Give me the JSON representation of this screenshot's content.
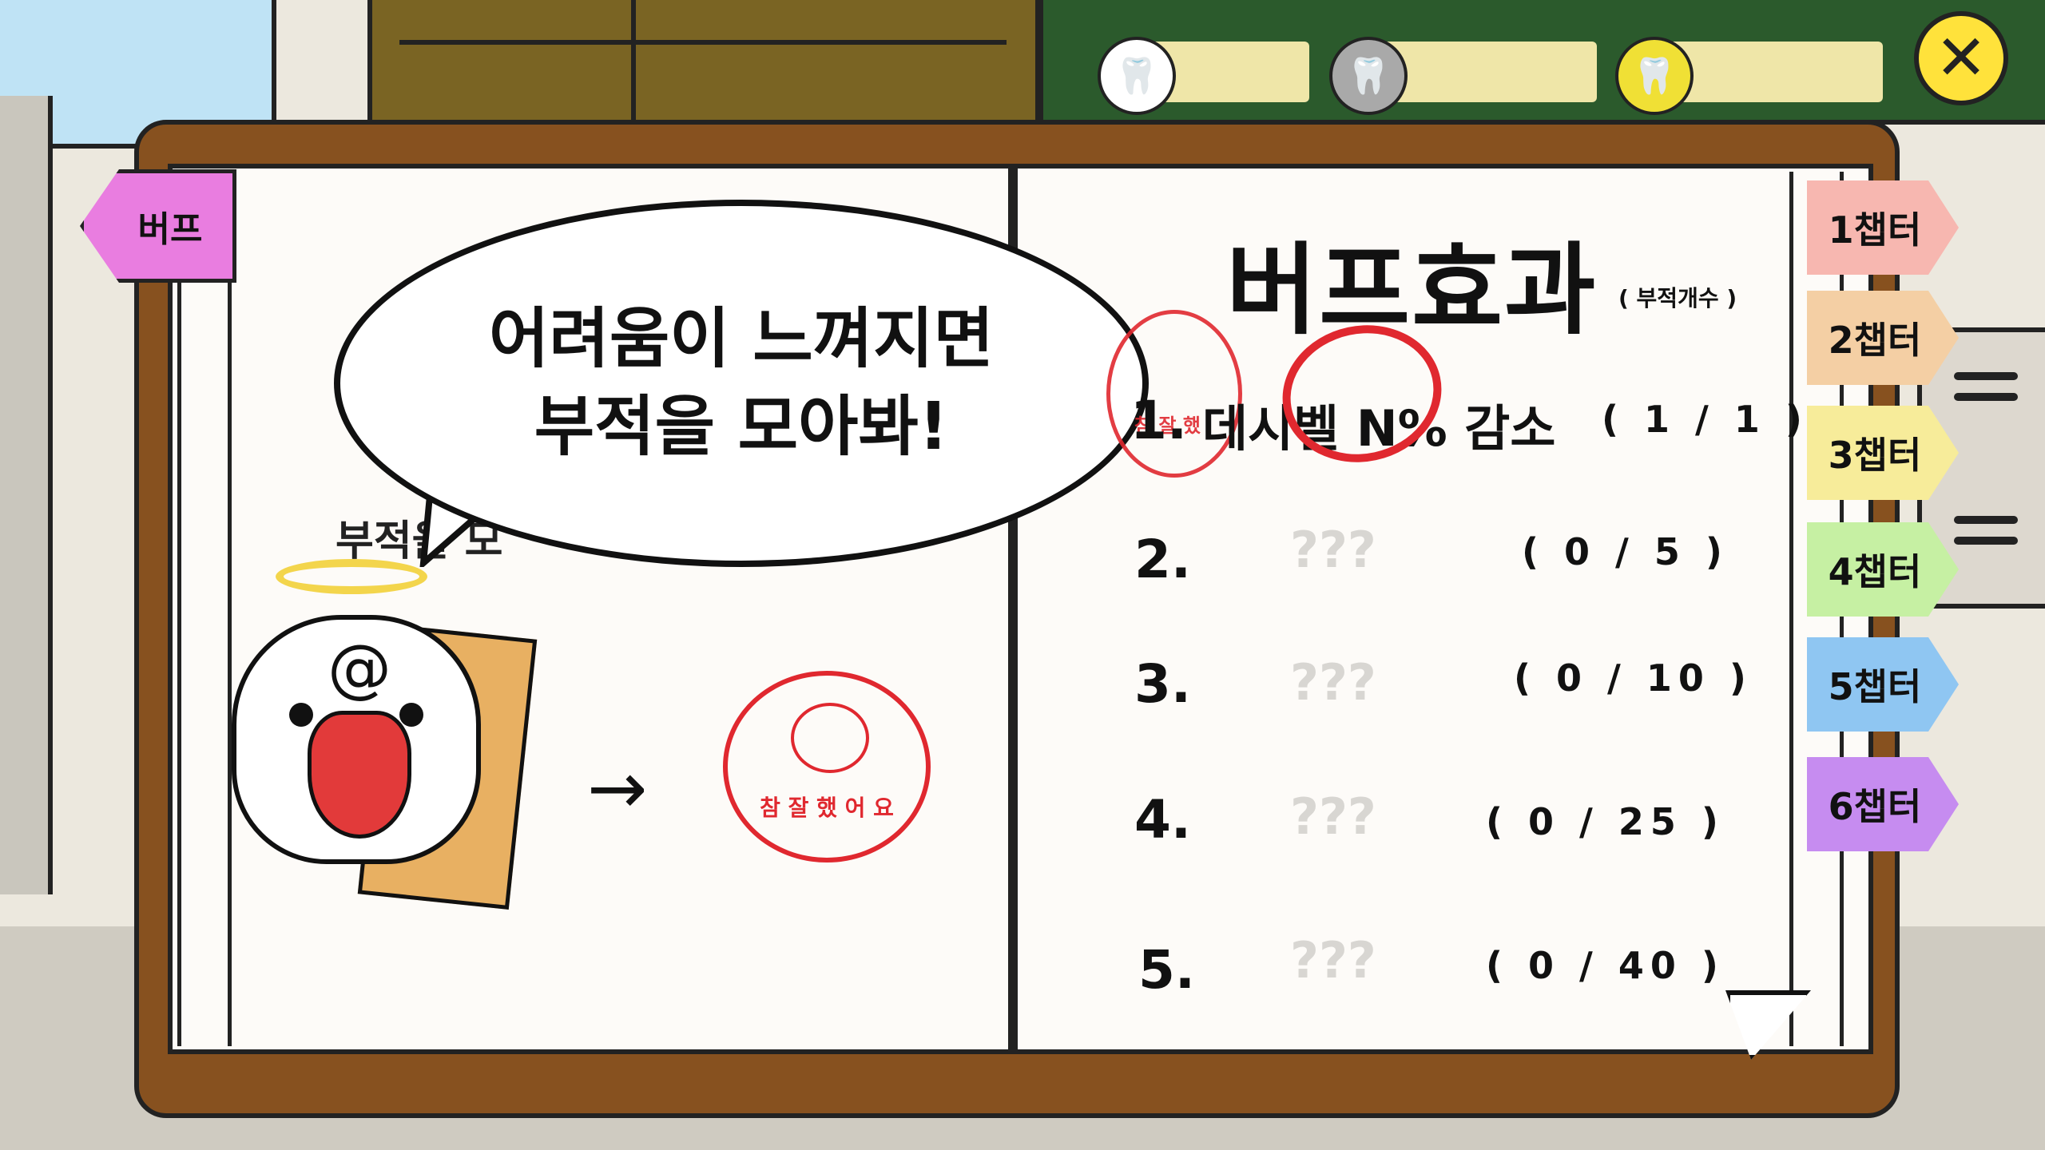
{
  "top_bar": {
    "currencies": [
      {
        "icon": "tooth-icon",
        "color": "#ffffff",
        "value": ""
      },
      {
        "icon": "silver-tooth-coin-icon",
        "color": "#a9a9a9",
        "value": ""
      },
      {
        "icon": "gold-tooth-coin-icon",
        "color": "#f0e035",
        "value": ""
      }
    ],
    "close_symbol": "✕"
  },
  "left_tab": {
    "label": "버프",
    "color": "#e97de0"
  },
  "chapter_tabs": [
    {
      "label": "1챕터",
      "color": "#f7b7b0"
    },
    {
      "label": "2챕터",
      "color": "#f4cfa4"
    },
    {
      "label": "3챕터",
      "color": "#f7ec9a"
    },
    {
      "label": "4챕터",
      "color": "#c6f0a3"
    },
    {
      "label": "5챕터",
      "color": "#8fc6f2"
    },
    {
      "label": "6챕터",
      "color": "#c68cf0"
    }
  ],
  "left_page": {
    "speech": {
      "line1": "어려움이 느껴지면",
      "line2": "부적을 모아봐!"
    },
    "hidden_caption": "부적을 모",
    "arrow": "→",
    "stamp_text": "참 잘 했 어 요"
  },
  "right_page": {
    "title": "버프효과",
    "subtitle": "( 부적개수 )",
    "buffs": [
      {
        "number": "1.",
        "name": "데시벨 N% 감소",
        "count": "( 1 / 1 )",
        "unlocked": true
      },
      {
        "number": "2.",
        "name": "???",
        "count": "( 0 / 5 )",
        "unlocked": false
      },
      {
        "number": "3.",
        "name": "???",
        "count": "( 0 / 10 )",
        "unlocked": false
      },
      {
        "number": "4.",
        "name": "???",
        "count": "( 0 / 25 )",
        "unlocked": false
      },
      {
        "number": "5.",
        "name": "???",
        "count": "( 0 / 40 )",
        "unlocked": false
      }
    ],
    "mini_stamp_text": "참 잘 했"
  }
}
